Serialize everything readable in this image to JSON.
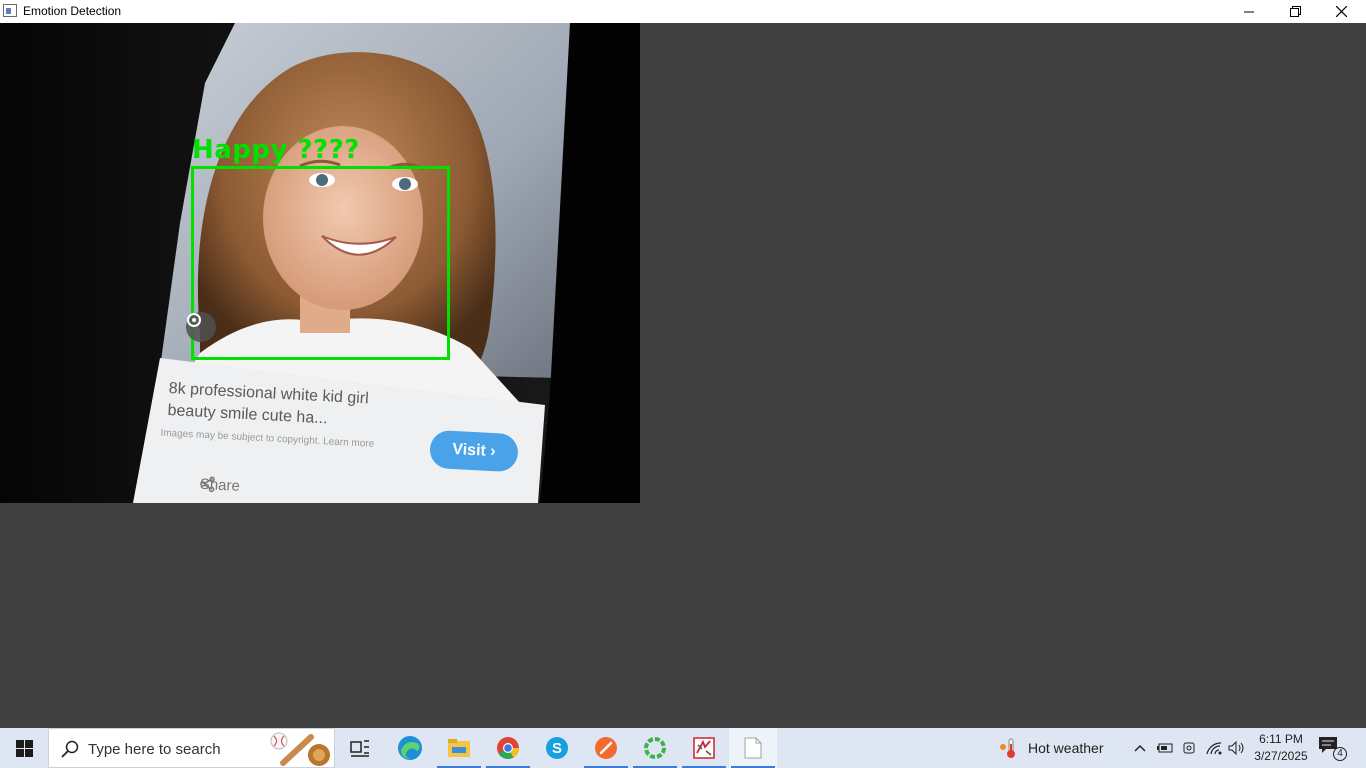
{
  "window": {
    "title": "Emotion Detection",
    "controls": [
      "minimize",
      "restore",
      "close"
    ]
  },
  "video": {
    "detection_label": "Happy ????",
    "box_color": "#00e100",
    "card": {
      "title_line1": "8k professional white kid girl",
      "title_line2": "beauty smile cute ha...",
      "disclaimer": "Images may be subject to copyright. Learn more",
      "visit_label": "Visit",
      "share_label": "Share"
    }
  },
  "taskbar": {
    "search_placeholder": "Type here to search",
    "apps": [
      {
        "name": "task-view-icon"
      },
      {
        "name": "edge-icon"
      },
      {
        "name": "file-explorer-icon"
      },
      {
        "name": "chrome-icon"
      },
      {
        "name": "skype-icon"
      },
      {
        "name": "pen-app-icon"
      },
      {
        "name": "green-ring-app-icon"
      },
      {
        "name": "paint-app-icon"
      },
      {
        "name": "blank-document-icon"
      }
    ],
    "weather": "Hot weather",
    "time": "6:11 PM",
    "date": "3/27/2025",
    "notification_count": "4"
  }
}
